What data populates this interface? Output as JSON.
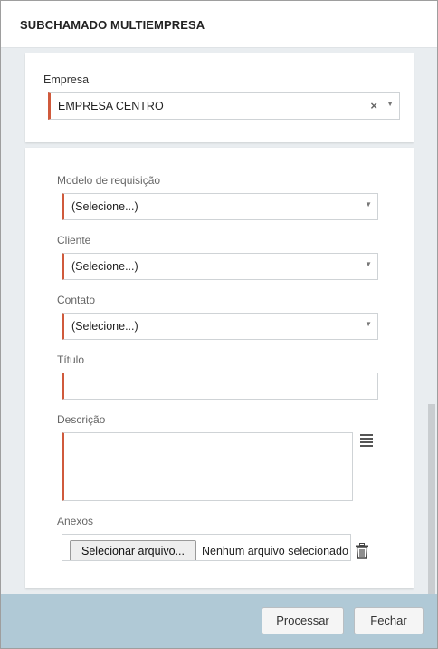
{
  "dialog": {
    "title": "SUBCHAMADO MULTIEMPRESA"
  },
  "empresa": {
    "label": "Empresa",
    "value": "EMPRESA CENTRO",
    "clear_symbol": "×",
    "caret_symbol": "▼"
  },
  "form": {
    "modelo": {
      "label": "Modelo de requisição",
      "value": "(Selecione...)"
    },
    "cliente": {
      "label": "Cliente",
      "value": "(Selecione...)"
    },
    "contato": {
      "label": "Contato",
      "value": "(Selecione...)"
    },
    "titulo": {
      "label": "Título",
      "value": ""
    },
    "descricao": {
      "label": "Descrição",
      "value": ""
    },
    "anexos": {
      "label": "Anexos",
      "button_label": "Selecionar arquivo...",
      "status": "Nenhum arquivo selecionado"
    },
    "caret_symbol": "▼"
  },
  "footer": {
    "process_label": "Processar",
    "close_label": "Fechar"
  },
  "icons": {
    "menu": "menu-icon",
    "trash": "trash-icon",
    "clear": "clear-icon",
    "caret": "chevron-down-icon"
  },
  "colors": {
    "required_accent": "#d05a3c",
    "footer_bg": "#b0c9d6",
    "body_bg": "#e9edf0"
  }
}
